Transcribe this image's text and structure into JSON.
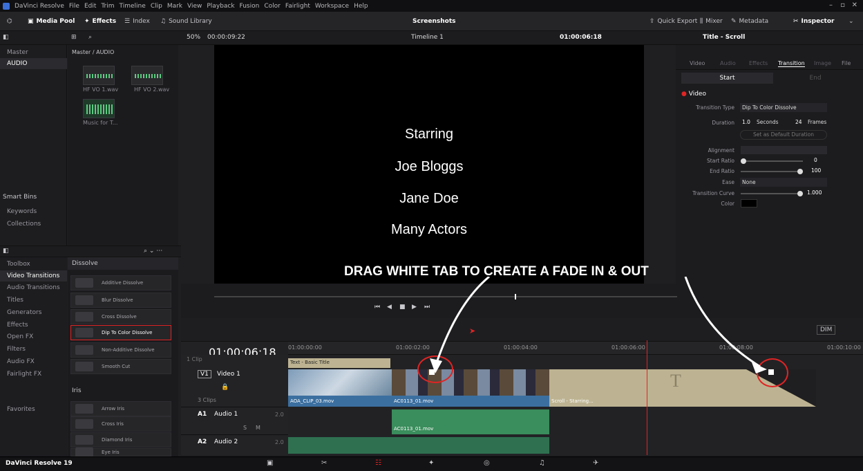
{
  "menubar": {
    "app": "DaVinci Resolve",
    "items": [
      "File",
      "Edit",
      "Trim",
      "Timeline",
      "Clip",
      "Mark",
      "View",
      "Playback",
      "Fusion",
      "Color",
      "Fairlight",
      "Workspace",
      "Help"
    ]
  },
  "toolbar": {
    "media_pool": "Media Pool",
    "effects": "Effects",
    "index": "Index",
    "sound_library": "Sound Library",
    "project_title": "Screenshots",
    "quick_export": "Quick Export",
    "mixer": "Mixer",
    "metadata": "Metadata",
    "inspector": "Inspector"
  },
  "viewerbar": {
    "zoom": "50%",
    "source_timecode": "00:00:09:22",
    "timeline_name": "Timeline 1",
    "record_timecode": "01:00:06:18",
    "inspector_title": "Title - Scroll"
  },
  "bins": {
    "master": "Master",
    "audio": "AUDIO",
    "path": "Master / AUDIO",
    "smart_bins": "Smart Bins",
    "keywords": "Keywords",
    "collections": "Collections"
  },
  "pool_items": [
    {
      "name": "HF VO 1.wav"
    },
    {
      "name": "HF VO 2.wav"
    },
    {
      "name": "Music for T..."
    }
  ],
  "fx_tree": [
    "Toolbox",
    "Video Transitions",
    "Audio Transitions",
    "Titles",
    "Generators",
    "Effects",
    "Open FX",
    "Filters",
    "Audio FX",
    "Fairlight FX",
    "Favorites"
  ],
  "fx_sections": {
    "dissolve": "Dissolve",
    "iris": "Iris"
  },
  "fx_dissolve": [
    "Additive Dissolve",
    "Blur Dissolve",
    "Cross Dissolve",
    "Dip To Color Dissolve",
    "Non-Additive Dissolve",
    "Smooth Cut"
  ],
  "fx_iris": [
    "Arrow Iris",
    "Cross Iris",
    "Diamond Iris",
    "Eye Iris"
  ],
  "viewer": {
    "lines": [
      "Starring",
      "Joe Bloggs",
      "Jane Doe",
      "Many Actors"
    ],
    "annotation": "DRAG WHITE TAB TO CREATE A FADE IN & OUT"
  },
  "inspector": {
    "tabs": [
      "Video",
      "Audio",
      "Effects",
      "Transition",
      "Image",
      "File"
    ],
    "active_tab": "Transition",
    "start": "Start",
    "end": "End",
    "section": "Video",
    "transition_type_label": "Transition Type",
    "transition_type": "Dip To Color Dissolve",
    "duration_label": "Duration",
    "duration_seconds": "1.0",
    "seconds_label": "Seconds",
    "duration_frames": "24",
    "frames_label": "Frames",
    "default_btn": "Set as Default Duration",
    "alignment_label": "Alignment",
    "start_ratio_label": "Start Ratio",
    "start_ratio": "0",
    "end_ratio_label": "End Ratio",
    "end_ratio": "100",
    "ease_label": "Ease",
    "ease": "None",
    "curve_label": "Transition Curve",
    "curve": "1.000",
    "color_label": "Color",
    "color_value": "#000000"
  },
  "timeline": {
    "timecode": "01:00:06:18",
    "ruler": [
      "01:00:00:00",
      "01:00:02:00",
      "01:00:04:00",
      "01:00:06:00",
      "01:00:08:00",
      "01:00:10:00"
    ],
    "title_track_clips": "1 Clip",
    "video_track_id": "V1",
    "video_track_name": "Video 1",
    "video_clips": "3 Clips",
    "audio1_id": "A1",
    "audio1_name": "Audio 1",
    "audio1_ch": "2.0",
    "audio2_id": "A2",
    "audio2_name": "Audio 2",
    "audio2_ch": "2.0",
    "title_clip": "Text - Basic Title",
    "clip1": "AOA_CLIP_03.mov",
    "clip2": "AC0113_01.mov",
    "clip3": "Scroll - Starring...",
    "audio_clip": "AC0113_01.mov",
    "dim": "DIM",
    "solo": "S",
    "mute": "M"
  },
  "bottom": {
    "app": "DaVinci Resolve 19"
  },
  "colors": {
    "accent": "#e02424",
    "audio": "#3a8d5c",
    "video": "#3b6fa0",
    "title": "#bdb392"
  }
}
